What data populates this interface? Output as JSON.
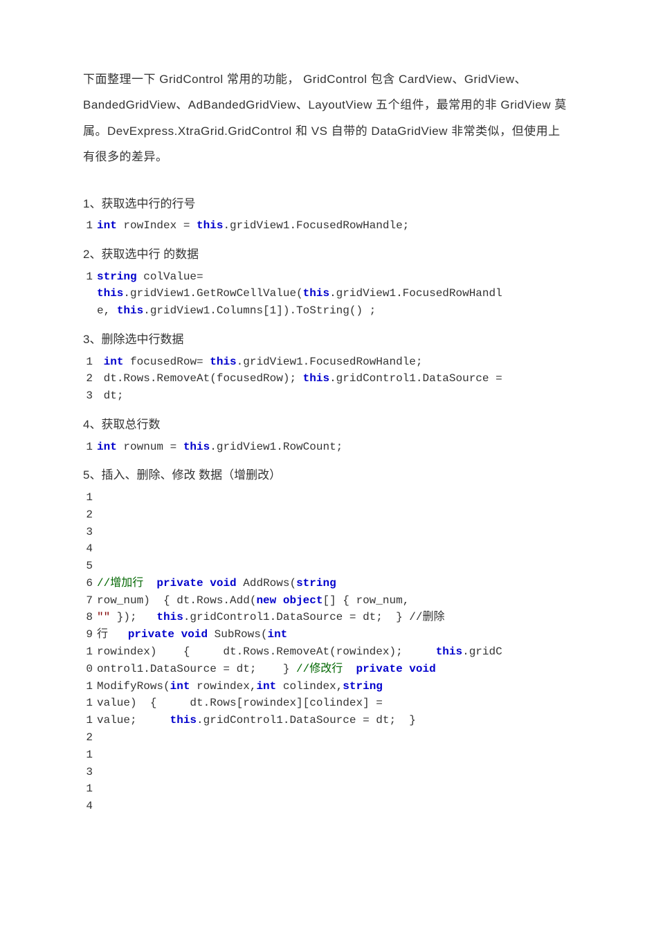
{
  "intro": "下面整理一下 GridControl  常用的功能，  GridControl  包含 CardView、GridView、BandedGridView、AdBandedGridView、LayoutView  五个组件，最常用的非 GridView 莫属。DevExpress.XtraGrid.GridControl  和 VS 自带的 DataGridView 非常类似，但使用上有很多的差异。",
  "s1": {
    "title": "1、获取选中行的行号"
  },
  "s2": {
    "title": "2、获取选中行  的数据"
  },
  "s3": {
    "title": "3、删除选中行数据"
  },
  "s4": {
    "title": "4、获取总行数"
  },
  "s5": {
    "title": "5、插入、删除、修改  数据（增删改）"
  },
  "t": {
    "int": "int",
    "string": "string",
    "this": "this",
    "new": "new",
    "object": "object",
    "private": "private",
    "void": "void",
    "rowIndexEq": " rowIndex = ",
    "gridView1": ".gridView1",
    "focusedRowHandleEnd": ".FocusedRowHandle;",
    "colValueEq": " colValue=",
    "getRowCellValueOpen": ".GetRowCellValue(",
    "focusedRowHandl": ".FocusedRowHandl",
    "eComma": "e, ",
    "columns1ToStr": ".Columns[1]).ToString() ;",
    "sp": " ",
    "focusedRowEq": " focusedRow= ",
    "dtRowsRemoveAt": "dt.Rows.RemoveAt(focusedRow); ",
    "gridControl1DataSourceEq": ".gridControl1.DataSource =",
    "dtSemi": "dt;",
    "rownumEq": " rownum = ",
    "rowCount": ".RowCount;",
    "addLineComment": "//增加行  ",
    "addRowsOpen": " AddRows(",
    "rowNumClose": "row_num)  { dt.Rows.Add(",
    "objArrOpen": "[] { row_num,",
    "emptyStr": "\"\"",
    "emptyStrClose": " });   ",
    "gridControl1DataSourceDt": ".gridControl1.DataSource = dt;",
    "closeBraceDelComment": "  } //删除",
    "rowPrivate": "行   ",
    "subRowsOpen": " SubRows(",
    "rowindexOpen": "rowindex)    {     dt.Rows.RemoveAt(rowindex);     ",
    "gridC": ".gridC",
    "ontrol1DataSourceDt": "ontrol1.DataSource = dt;    } ",
    "modifyComment": "//修改行  ",
    "modifyRowsOpen": "ModifyRows(",
    "rowindexArg": " rowindex,",
    "colindexArg": " colindex,",
    "valueOpen": "value)  {     dt.Rows[rowindex][colindex] =",
    "valueSemi": "value;     ",
    "dataSourceDtClose": ".gridControl1.DataSource = dt;  }"
  },
  "ln": {
    "n1": "1",
    "n2": "2",
    "n3": "3",
    "n4": "4",
    "n5": "5",
    "n6": "6",
    "n7": "7",
    "n8": "8",
    "n9": "9",
    "n10": "1",
    "n10b": "0",
    "n11": "1",
    "n11b": "1",
    "n12": "1",
    "n12b": "2",
    "n13": "1",
    "n13b": "3",
    "n14": "1",
    "n14b": "4"
  }
}
